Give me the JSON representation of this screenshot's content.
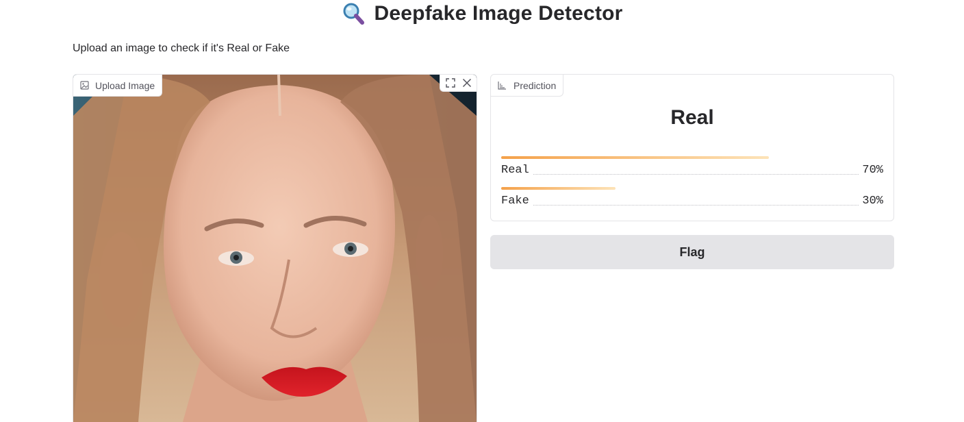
{
  "header": {
    "title": "Deepfake Image Detector",
    "title_icon": "magnifier-icon",
    "subtitle": "Upload an image to check if it's Real or Fake"
  },
  "image_input": {
    "label": "Upload Image",
    "label_icon": "image-icon",
    "controls": [
      "fullscreen-icon",
      "close-icon"
    ]
  },
  "prediction": {
    "label": "Prediction",
    "label_icon": "bar-chart-icon",
    "top_label": "Real",
    "confidences": [
      {
        "name": "Real",
        "value": 0.7,
        "percent": "70%"
      },
      {
        "name": "Fake",
        "value": 0.3,
        "percent": "30%"
      }
    ]
  },
  "actions": {
    "flag_label": "Flag"
  },
  "colors": {
    "bar_start": "#f4a14a",
    "bar_end": "#fde3b8",
    "button_bg": "#e4e4e7",
    "border": "#e4e4e7"
  }
}
